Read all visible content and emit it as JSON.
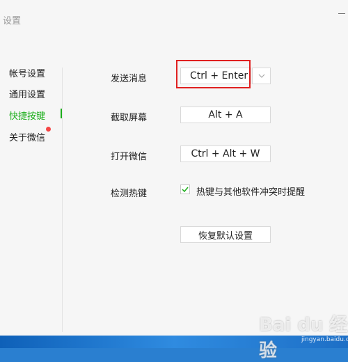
{
  "window": {
    "title": "设置"
  },
  "sidebar": {
    "items": [
      {
        "label": "帐号设置"
      },
      {
        "label": "通用设置"
      },
      {
        "label": "快捷按键"
      },
      {
        "label": "关于微信"
      }
    ]
  },
  "shortcuts": {
    "send_message_label": "发送消息",
    "send_message_key": "Ctrl + Enter",
    "screenshot_label": "截取屏幕",
    "screenshot_key": "Alt + A",
    "open_wechat_label": "打开微信",
    "open_wechat_key": "Ctrl + Alt + W",
    "detect_hotkey_label": "检测热键",
    "detect_hotkey_checkbox_label": "热键与其他软件冲突时提醒",
    "detect_hotkey_checked": true,
    "reset_button_label": "恢复默认设置"
  },
  "colors": {
    "accent_green": "#1aad19",
    "highlight_red": "#e02020",
    "badge_red": "#f54545"
  },
  "watermark": {
    "logo": "Bai du 经验",
    "url": "jingyan.baidu.com"
  }
}
